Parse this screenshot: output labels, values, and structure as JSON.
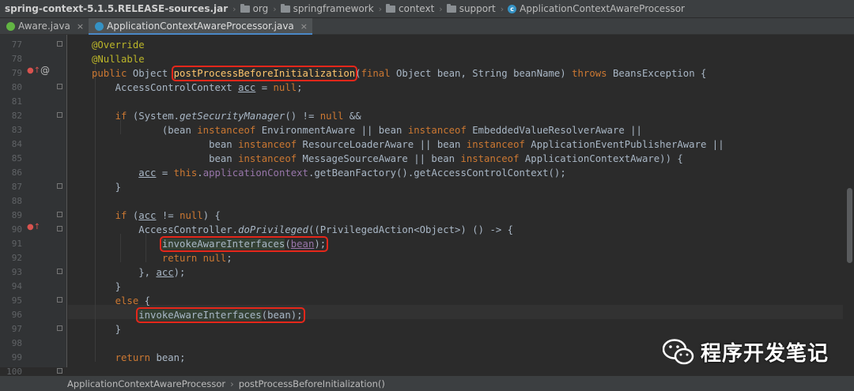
{
  "breadcrumb": {
    "items": [
      {
        "label": "spring-context-5.1.5.RELEASE-sources.jar",
        "icon": "jar-icon"
      },
      {
        "label": "org",
        "icon": "folder-icon"
      },
      {
        "label": "springframework",
        "icon": "folder-icon"
      },
      {
        "label": "context",
        "icon": "folder-icon"
      },
      {
        "label": "support",
        "icon": "folder-icon"
      },
      {
        "label": "ApplicationContextAwareProcessor",
        "icon": "class-icon"
      }
    ]
  },
  "tabs": [
    {
      "label": "Aware.java",
      "icon": "interface-icon",
      "active": false
    },
    {
      "label": "ApplicationContextAwareProcessor.java",
      "icon": "class-icon",
      "active": true
    }
  ],
  "lines": [
    {
      "n": "77",
      "html": "<span class=\"ann\">@Override</span>"
    },
    {
      "n": "78",
      "html": "<span class=\"ann\">@Nullable</span>"
    },
    {
      "n": "79",
      "html": "<span class=\"kw\">public</span> Object <span class=\"meth hl\">postProcessBeforeInitialization</span>(<span class=\"kw\">final</span> Object bean, String beanName) <span class=\"kw\">throws</span> BeansException {"
    },
    {
      "n": "80",
      "html": "    AccessControlContext <span class=\"und\">acc</span> = <span class=\"kw\">null</span>;"
    },
    {
      "n": "81",
      "html": ""
    },
    {
      "n": "82",
      "html": "    <span class=\"kw\">if</span> (System.<span class=\"itl\">getSecurityManager</span>() != <span class=\"kw\">null</span> &amp;&amp;"
    },
    {
      "n": "83",
      "html": "            (bean <span class=\"kw\">instanceof</span> EnvironmentAware || bean <span class=\"kw\">instanceof</span> EmbeddedValueResolverAware ||"
    },
    {
      "n": "84",
      "html": "                    bean <span class=\"kw\">instanceof</span> ResourceLoaderAware || bean <span class=\"kw\">instanceof</span> ApplicationEventPublisherAware ||"
    },
    {
      "n": "85",
      "html": "                    bean <span class=\"kw\">instanceof</span> MessageSourceAware || bean <span class=\"kw\">instanceof</span> ApplicationContextAware)) {"
    },
    {
      "n": "86",
      "html": "        <span class=\"und\">acc</span> = <span class=\"kw\">this</span>.<span class=\"fld\">applicationContext</span>.getBeanFactory().getAccessControlContext();"
    },
    {
      "n": "87",
      "html": "    }"
    },
    {
      "n": "88",
      "html": ""
    },
    {
      "n": "89",
      "html": "    <span class=\"kw\">if</span> (<span class=\"und\">acc</span> != <span class=\"kw\">null</span>) {"
    },
    {
      "n": "90",
      "html": "        AccessController.<span class=\"itl\">doPrivileged</span>((PrivilegedAction&lt;Object&gt;) () -&gt; {"
    },
    {
      "n": "91",
      "html": "            <span class=\"hl\"><span class=\"box-under\">invokeAwareInterfaces</span>(<span class=\"fld und\">bean</span>);</span>"
    },
    {
      "n": "92",
      "html": "            <span class=\"kw\">return null</span>;"
    },
    {
      "n": "93",
      "html": "        }, <span class=\"und\">acc</span>);"
    },
    {
      "n": "94",
      "html": "    }"
    },
    {
      "n": "95",
      "html": "    <span class=\"kw\">else</span> {"
    },
    {
      "n": "96",
      "html": "        <span class=\"hl\"><span class=\"box-under\">invokeAwareInterfaces</span>(bean);</span>"
    },
    {
      "n": "97",
      "html": "    }"
    },
    {
      "n": "98",
      "html": ""
    },
    {
      "n": "99",
      "html": "    <span class=\"kw\">return</span> bean;"
    },
    {
      "n": "100",
      "html": "}"
    }
  ],
  "status": {
    "class_label": "ApplicationContextAwareProcessor",
    "method_label": "postProcessBeforeInitialization()"
  },
  "watermark": {
    "text": "程序开发笔记",
    "icon": "wechat-icon"
  }
}
